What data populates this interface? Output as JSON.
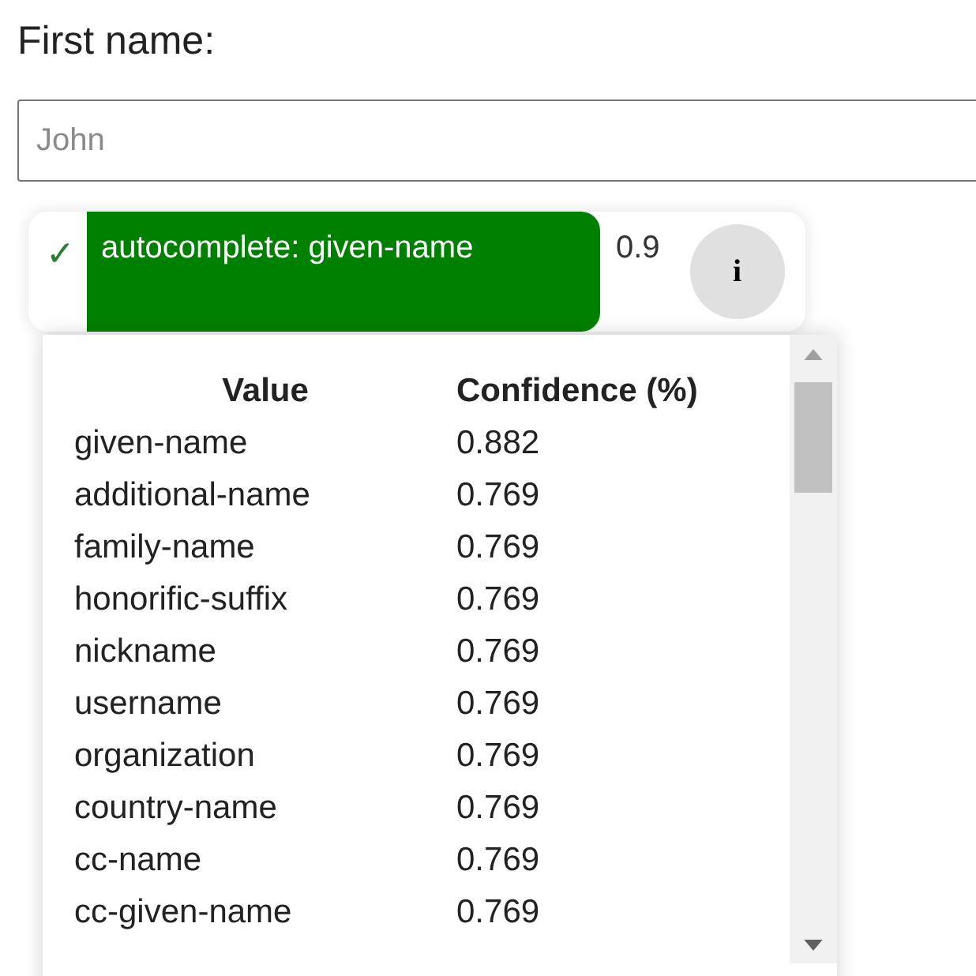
{
  "field": {
    "label": "First name:",
    "placeholder": "John"
  },
  "badge": {
    "check": "✓",
    "status": "autocomplete: given-name",
    "score": "0.9",
    "info": "i"
  },
  "dropdown": {
    "columns": [
      "Value",
      "Confidence (%)"
    ],
    "rows": [
      [
        "given-name",
        "0.882"
      ],
      [
        "additional-name",
        "0.769"
      ],
      [
        "family-name",
        "0.769"
      ],
      [
        "honorific-suffix",
        "0.769"
      ],
      [
        "nickname",
        "0.769"
      ],
      [
        "username",
        "0.769"
      ],
      [
        "organization",
        "0.769"
      ],
      [
        "country-name",
        "0.769"
      ],
      [
        "cc-name",
        "0.769"
      ],
      [
        "cc-given-name",
        "0.769"
      ]
    ]
  }
}
